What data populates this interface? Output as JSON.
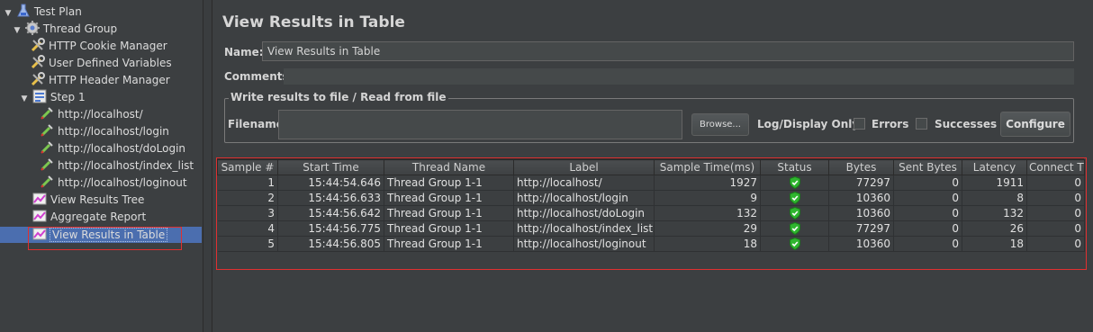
{
  "tree": {
    "items": [
      {
        "label": "Test Plan",
        "icon": "test-plan-icon"
      },
      {
        "label": "Thread Group",
        "icon": "gear-icon"
      },
      {
        "label": "HTTP Cookie Manager",
        "icon": "wrench-icon"
      },
      {
        "label": "User Defined Variables",
        "icon": "wrench-icon"
      },
      {
        "label": "HTTP Header Manager",
        "icon": "wrench-icon"
      },
      {
        "label": "Step 1",
        "icon": "controller-icon"
      },
      {
        "label": "http://localhost/",
        "icon": "pipette-icon"
      },
      {
        "label": "http://localhost/login",
        "icon": "pipette-icon"
      },
      {
        "label": "http://localhost/doLogin",
        "icon": "pipette-icon"
      },
      {
        "label": "http://localhost/index_list",
        "icon": "pipette-icon"
      },
      {
        "label": "http://localhost/loginout",
        "icon": "pipette-icon"
      },
      {
        "label": "View Results Tree",
        "icon": "listener-icon"
      },
      {
        "label": "Aggregate Report",
        "icon": "listener-icon"
      },
      {
        "label": "View Results in Table",
        "icon": "listener-icon"
      }
    ],
    "selected_index": 13
  },
  "panel": {
    "title": "View Results in Table",
    "name_label": "Name:",
    "name_value": "View Results in Table",
    "comments_label": "Comments:",
    "file_legend": "Write results to file / Read from file",
    "filename_label": "Filename",
    "browse_label": "Browse...",
    "log_display_label": "Log/Display Only:",
    "errors_label": "Errors",
    "successes_label": "Successes",
    "configure_label": "Configure"
  },
  "table": {
    "columns": [
      "Sample #",
      "Start Time",
      "Thread Name",
      "Label",
      "Sample Time(ms)",
      "Status",
      "Bytes",
      "Sent Bytes",
      "Latency",
      "Connect Ti..."
    ],
    "rows": [
      [
        "1",
        "15:44:54.646",
        "Thread Group 1-1",
        "http://localhost/",
        "1927",
        "success",
        "77297",
        "0",
        "1911",
        "0"
      ],
      [
        "2",
        "15:44:56.633",
        "Thread Group 1-1",
        "http://localhost/login",
        "9",
        "success",
        "10360",
        "0",
        "8",
        "0"
      ],
      [
        "3",
        "15:44:56.642",
        "Thread Group 1-1",
        "http://localhost/doLogin",
        "132",
        "success",
        "10360",
        "0",
        "132",
        "0"
      ],
      [
        "4",
        "15:44:56.775",
        "Thread Group 1-1",
        "http://localhost/index_list",
        "29",
        "success",
        "77297",
        "0",
        "26",
        "0"
      ],
      [
        "5",
        "15:44:56.805",
        "Thread Group 1-1",
        "http://localhost/loginout",
        "18",
        "success",
        "10360",
        "0",
        "18",
        "0"
      ]
    ]
  },
  "colors": {
    "background": "#3c3f41",
    "selection": "#4b6eaf",
    "highlight": "#e03030",
    "success": "#2fb52f"
  }
}
